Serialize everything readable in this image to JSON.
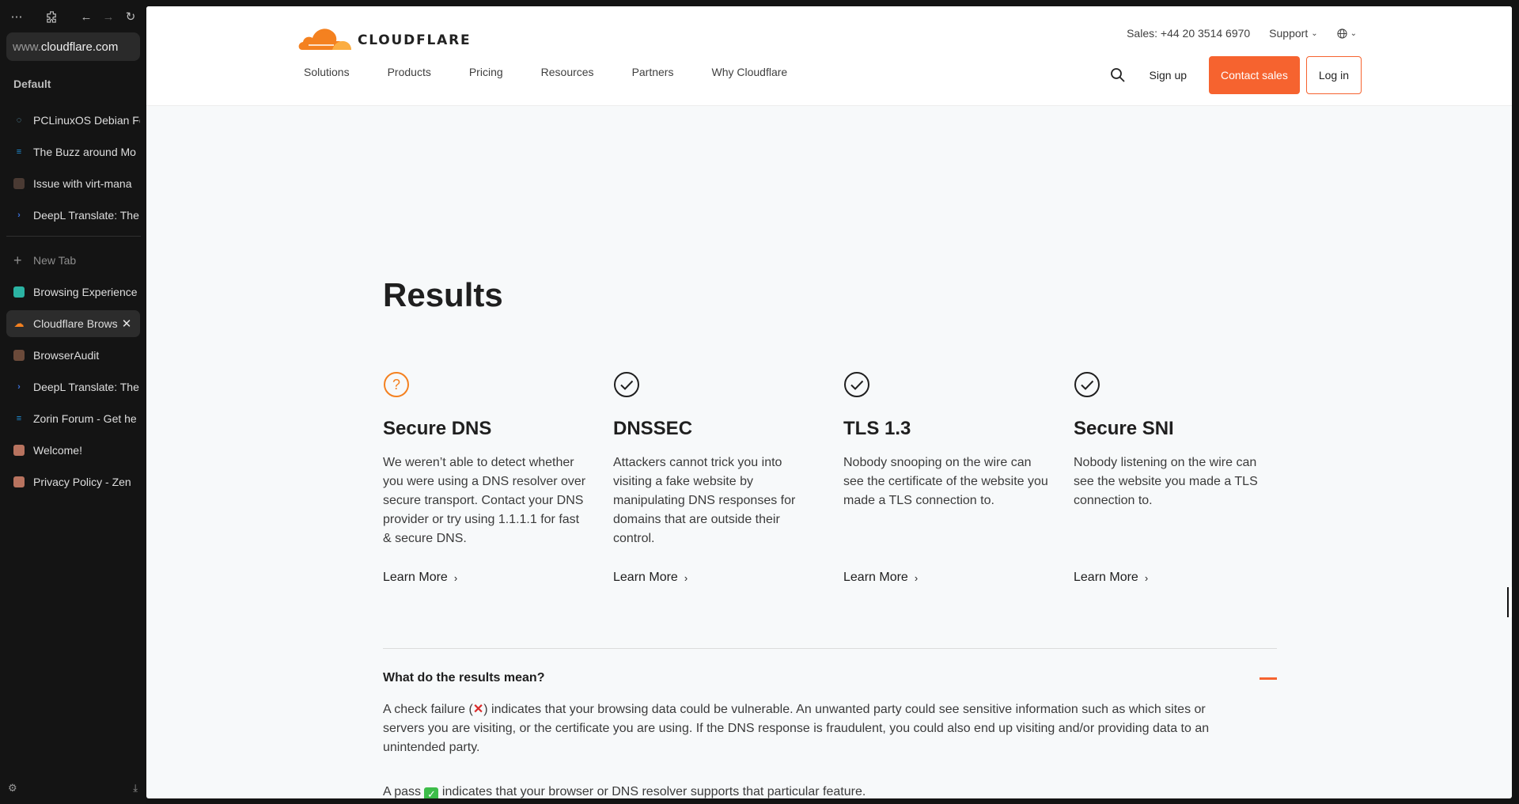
{
  "browser": {
    "url_prefix": "www.",
    "url_domain": "cloudflare.com",
    "section_label": "Default",
    "pinned_tabs": [
      {
        "label": "PCLinuxOS Debian Fo",
        "icon": "chat-bubble-icon",
        "color": "#6fb7d6"
      },
      {
        "label": "The Buzz around Mo",
        "icon": "zorin-icon",
        "color": "#1f8fd6"
      },
      {
        "label": "Issue with virt-mana",
        "icon": "square-icon",
        "color": "#4a3a33"
      },
      {
        "label": "DeepL Translate: The",
        "icon": "deepl-icon",
        "color": "#3a6fd6"
      }
    ],
    "new_tab_label": "New Tab",
    "tabs": [
      {
        "label": "Browsing Experience",
        "icon": "browsing-exp-icon",
        "color": "#2bb3a3",
        "active": false
      },
      {
        "label": "Cloudflare Brows",
        "icon": "cloudflare-icon",
        "color": "#f48120",
        "active": true
      },
      {
        "label": "BrowserAudit",
        "icon": "square-icon",
        "color": "#6b4a3a",
        "active": false
      },
      {
        "label": "DeepL Translate: The",
        "icon": "deepl-icon",
        "color": "#3a6fd6",
        "active": false
      },
      {
        "label": "Zorin Forum - Get he",
        "icon": "zorin-icon",
        "color": "#1f8fd6",
        "active": false
      },
      {
        "label": "Welcome!",
        "icon": "zen-icon",
        "color": "#b8735f",
        "active": false
      },
      {
        "label": "Privacy Policy - Zen",
        "icon": "zen-icon",
        "color": "#b8735f",
        "active": false
      }
    ]
  },
  "site": {
    "logo_text": "CLOUDFLARE",
    "sales": "Sales: +44 20 3514 6970",
    "support": "Support",
    "nav": [
      "Solutions",
      "Products",
      "Pricing",
      "Resources",
      "Partners",
      "Why Cloudflare"
    ],
    "sign_up": "Sign up",
    "contact_sales": "Contact sales",
    "log_in": "Log in",
    "accent": "#f6632f"
  },
  "results": {
    "title": "Results",
    "cards": [
      {
        "title": "Secure DNS",
        "status": "unknown",
        "icon": "question-circle-icon",
        "text": "We weren’t able to detect whether you were using a DNS resolver over secure transport. Contact your DNS provider or try using 1.1.1.1 for fast & secure DNS.",
        "link": "Learn More"
      },
      {
        "title": "DNSSEC",
        "status": "pass",
        "icon": "check-circle-icon",
        "text": "Attackers cannot trick you into visiting a fake website by manipulating DNS responses for domains that are outside their control.",
        "link": "Learn More"
      },
      {
        "title": "TLS 1.3",
        "status": "pass",
        "icon": "check-circle-icon",
        "text": "Nobody snooping on the wire can see the certificate of the website you made a TLS connection to.",
        "link": "Learn More"
      },
      {
        "title": "Secure SNI",
        "status": "pass",
        "icon": "check-circle-icon",
        "text": "Nobody listening on the wire can see the website you made a TLS connection to.",
        "link": "Learn More"
      }
    ]
  },
  "faq": {
    "question": "What do the results mean?",
    "answer_fail_before": "A check failure (",
    "answer_fail_after": ") indicates that your browsing data could be vulnerable. An unwanted party could see sensitive information such as which sites or servers you are visiting, or the certificate you are using. If the DNS response is fraudulent, you could also end up visiting and/or providing data to an unintended party.",
    "answer_pass_before": "A pass ",
    "answer_pass_after": " indicates that your browser or DNS resolver supports that particular feature."
  }
}
